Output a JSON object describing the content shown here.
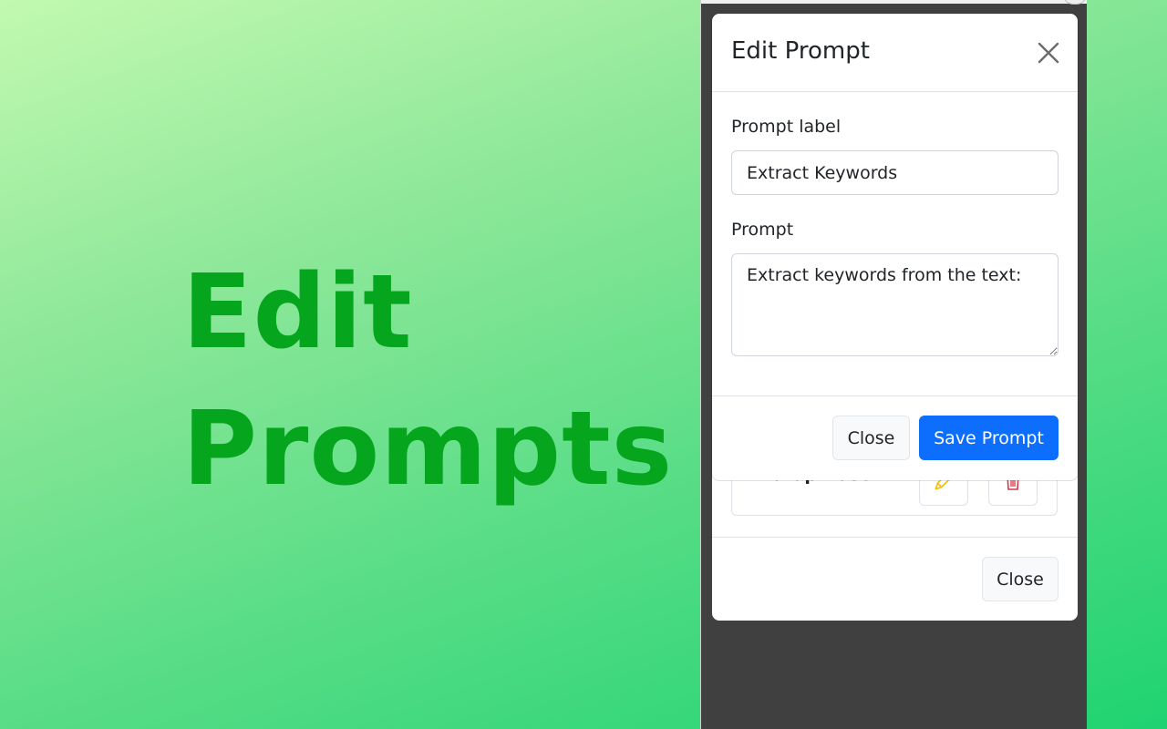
{
  "headline": {
    "line1": "Edit",
    "line2": "Prompts"
  },
  "background_modal": {
    "list_item_label": "Paraphrase",
    "edit_icon": "pencil-icon",
    "delete_icon": "trash-icon",
    "close_label": "Close"
  },
  "edit_modal": {
    "title": "Edit Prompt",
    "close_icon": "close-icon",
    "label_field_label": "Prompt label",
    "label_field_value": "Extract Keywords",
    "prompt_field_label": "Prompt",
    "prompt_field_value": "Extract keywords from the text:",
    "close_button_label": "Close",
    "save_button_label": "Save Prompt"
  },
  "colors": {
    "headline": "#05a51d",
    "primary": "#0d6efd",
    "edit_icon": "#f5c400",
    "delete_icon": "#dc3545",
    "frame": "#404040"
  }
}
